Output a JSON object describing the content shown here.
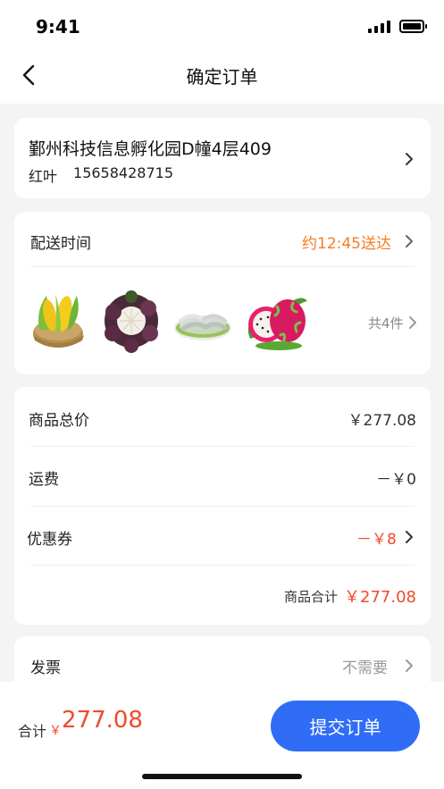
{
  "status_bar": {
    "time": "9:41"
  },
  "nav": {
    "title": "确定订单",
    "back_icon": "chevron-left-icon"
  },
  "address": {
    "line": "鄞州科技信息孵化园D幢4层409",
    "name": "红叶",
    "phone": "15658428715"
  },
  "delivery": {
    "label": "配送时间",
    "value": "约12:45送达",
    "items": [
      {
        "name": "corn-image"
      },
      {
        "name": "mangosteen-image"
      },
      {
        "name": "shrimp-image"
      },
      {
        "name": "dragonfruit-image"
      }
    ],
    "count_label": "共4件"
  },
  "pricing": {
    "subtotal_label": "商品总价",
    "subtotal_value": "￥277.08",
    "shipping_label": "运费",
    "shipping_value": "－￥0",
    "coupon_label": "优惠券",
    "coupon_value": "－￥8",
    "sum_label": "商品合计",
    "sum_value": "￥277.08"
  },
  "invoice": {
    "label": "发票",
    "value": "不需要"
  },
  "footer": {
    "total_label": "合计",
    "currency": "￥",
    "total_amount": "277.08",
    "submit_label": "提交订单"
  },
  "colors": {
    "accent_orange": "#f47c20",
    "price_red": "#f04a2a",
    "button_blue": "#2f6df6"
  }
}
